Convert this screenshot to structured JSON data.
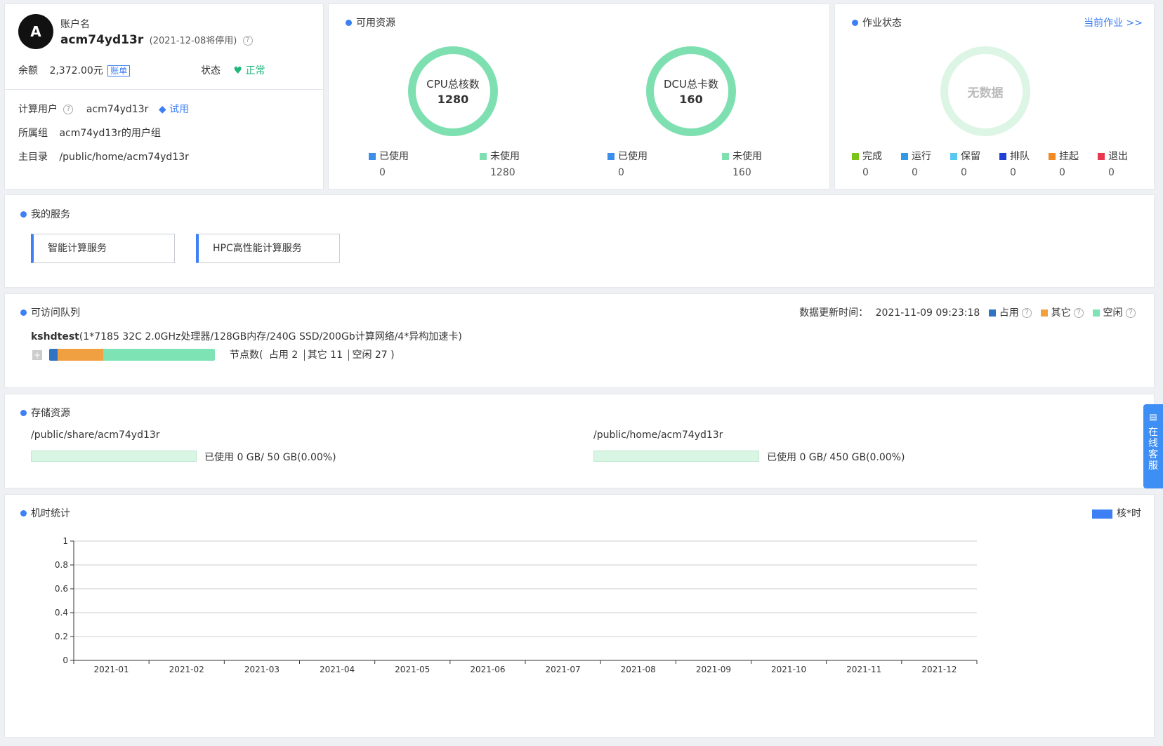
{
  "account": {
    "avatar_letter": "A",
    "label": "账户名",
    "name": "acm74yd13r",
    "expire_note": "(2021-12-08将停用)",
    "balance_label": "余额",
    "balance_value": "2,372.00元",
    "bill_link": "账单",
    "status_label": "状态",
    "status_value": "正常",
    "compute_user_label": "计算用户",
    "compute_user_value": "acm74yd13r",
    "trial_badge": "试用",
    "group_label": "所属组",
    "group_value": "acm74yd13r的用户组",
    "home_label": "主目录",
    "home_value": "/public/home/acm74yd13r"
  },
  "resources": {
    "title": "可用资源",
    "cpu": {
      "label": "CPU总核数",
      "total": "1280",
      "used_label": "已使用",
      "used": "0",
      "unused_label": "未使用",
      "unused": "1280"
    },
    "dcu": {
      "label": "DCU总卡数",
      "total": "160",
      "used_label": "已使用",
      "used": "0",
      "unused_label": "未使用",
      "unused": "160"
    },
    "colors": {
      "used": "#3b8fe8",
      "unused": "#7ee0b0"
    }
  },
  "jobs": {
    "title": "作业状态",
    "current_link": "当前作业 >>",
    "no_data": "无数据",
    "states": [
      {
        "label": "完成",
        "value": "0",
        "color": "#7cc41a"
      },
      {
        "label": "运行",
        "value": "0",
        "color": "#2f9be8"
      },
      {
        "label": "保留",
        "value": "0",
        "color": "#59c8f0"
      },
      {
        "label": "排队",
        "value": "0",
        "color": "#1f3fd6"
      },
      {
        "label": "挂起",
        "value": "0",
        "color": "#f08a24"
      },
      {
        "label": "退出",
        "value": "0",
        "color": "#e8384f"
      }
    ]
  },
  "services": {
    "title": "我的服务",
    "items": [
      "智能计算服务",
      "HPC高性能计算服务"
    ]
  },
  "queues": {
    "title": "可访问队列",
    "update_label": "数据更新时间：",
    "update_time": "2021-11-09 09:23:18",
    "legend": [
      {
        "label": "占用",
        "color": "#3072c4"
      },
      {
        "label": "其它",
        "color": "#f0a040"
      },
      {
        "label": "空闲",
        "color": "#7ee3b4"
      }
    ],
    "queue_name": "kshdtest",
    "queue_desc": "(1*7185 32C 2.0GHz处理器/128GB内存/240G SSD/200Gb计算网络/4*异构加速卡)",
    "expand_icon": "+",
    "node_prefix": "节点数(",
    "node_used": "占用 2",
    "node_other": "其它 11",
    "node_idle": "空闲 27 )",
    "counts": {
      "used": 2,
      "other": 11,
      "idle": 27
    }
  },
  "storage": {
    "title": "存储资源",
    "items": [
      {
        "path": "/public/share/acm74yd13r",
        "usage": "已使用 0 GB/ 50 GB(0.00%)",
        "fraction": 0
      },
      {
        "path": "/public/home/acm74yd13r",
        "usage": "已使用 0 GB/ 450 GB(0.00%)",
        "fraction": 0
      }
    ]
  },
  "side_tab": {
    "icon": "chat-icon",
    "chars": [
      "在",
      "线",
      "客",
      "服"
    ]
  },
  "machine_time": {
    "title": "机时统计",
    "legend_label": "核*时",
    "legend_color": "#3d7ff5"
  },
  "chart_data": {
    "type": "bar",
    "title": "",
    "categories": [
      "2021-01",
      "2021-02",
      "2021-03",
      "2021-04",
      "2021-05",
      "2021-06",
      "2021-07",
      "2021-08",
      "2021-09",
      "2021-10",
      "2021-11",
      "2021-12"
    ],
    "series": [
      {
        "name": "核*时",
        "values": [
          0,
          0,
          0,
          0,
          0,
          0,
          0,
          0,
          0,
          0,
          0,
          0
        ]
      }
    ],
    "y_ticks": [
      "0",
      "0.2",
      "0.4",
      "0.6",
      "0.8",
      "1"
    ],
    "ylim": [
      0,
      1
    ],
    "grid": true,
    "legend": "top-right"
  }
}
